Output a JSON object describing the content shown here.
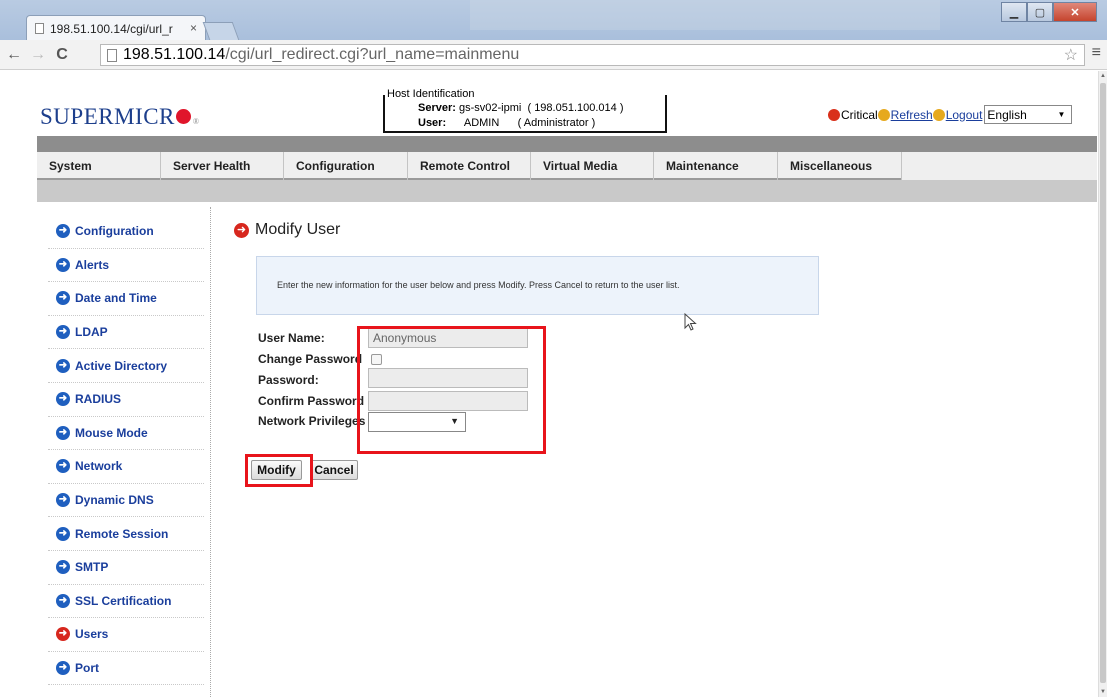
{
  "browser": {
    "tab_title": "198.51.100.14/cgi/url_r",
    "tab_close": "×",
    "url_host": "198.51.100.14",
    "url_path": "/cgi/url_redirect.cgi?url_name=mainmenu",
    "back_glyph": "←",
    "forward_glyph": "→",
    "reload_glyph": "C",
    "star_glyph": "☆",
    "menu_glyph": "≡"
  },
  "header": {
    "logo_text": "SUPERMICR",
    "host_identification": {
      "legend": "Host Identification",
      "server_label": "Server:",
      "server_value": "gs-sv02-ipmi",
      "server_ip": "( 198.051.100.014 )",
      "user_label": "User:",
      "user_value": "ADMIN",
      "user_role": "( Administrator )"
    },
    "critical": "Critical",
    "refresh": "Refresh",
    "logout": "Logout",
    "language": "English"
  },
  "nav": {
    "items": [
      "System",
      "Server Health",
      "Configuration",
      "Remote Control",
      "Virtual Media",
      "Maintenance",
      "Miscellaneous"
    ]
  },
  "sidebar": {
    "items": [
      {
        "label": "Configuration",
        "active": false
      },
      {
        "label": "Alerts",
        "active": false
      },
      {
        "label": "Date and Time",
        "active": false
      },
      {
        "label": "LDAP",
        "active": false
      },
      {
        "label": "Active Directory",
        "active": false
      },
      {
        "label": "RADIUS",
        "active": false
      },
      {
        "label": "Mouse Mode",
        "active": false
      },
      {
        "label": "Network",
        "active": false
      },
      {
        "label": "Dynamic DNS",
        "active": false
      },
      {
        "label": "Remote Session",
        "active": false
      },
      {
        "label": "SMTP",
        "active": false
      },
      {
        "label": "SSL Certification",
        "active": false
      },
      {
        "label": "Users",
        "active": true
      },
      {
        "label": "Port",
        "active": false
      }
    ]
  },
  "main": {
    "title": "Modify User",
    "info": "Enter the new information for the user below and press Modify. Press Cancel to return to the user list.",
    "form": {
      "user_name_label": "User Name:",
      "user_name_value": "Anonymous",
      "change_password_label": "Change Password",
      "change_password_checked": false,
      "password_label": "Password:",
      "password_value": "",
      "confirm_password_label": "Confirm Password",
      "confirm_password_value": "",
      "network_privileges_label": "Network Privileges",
      "network_privileges_value": ""
    },
    "modify_button": "Modify",
    "cancel_button": "Cancel"
  },
  "colors": {
    "highlight": "#e8141b",
    "link": "#1a3e9c",
    "brand": "#1d3f8c",
    "brand_dot": "#e0152b"
  }
}
